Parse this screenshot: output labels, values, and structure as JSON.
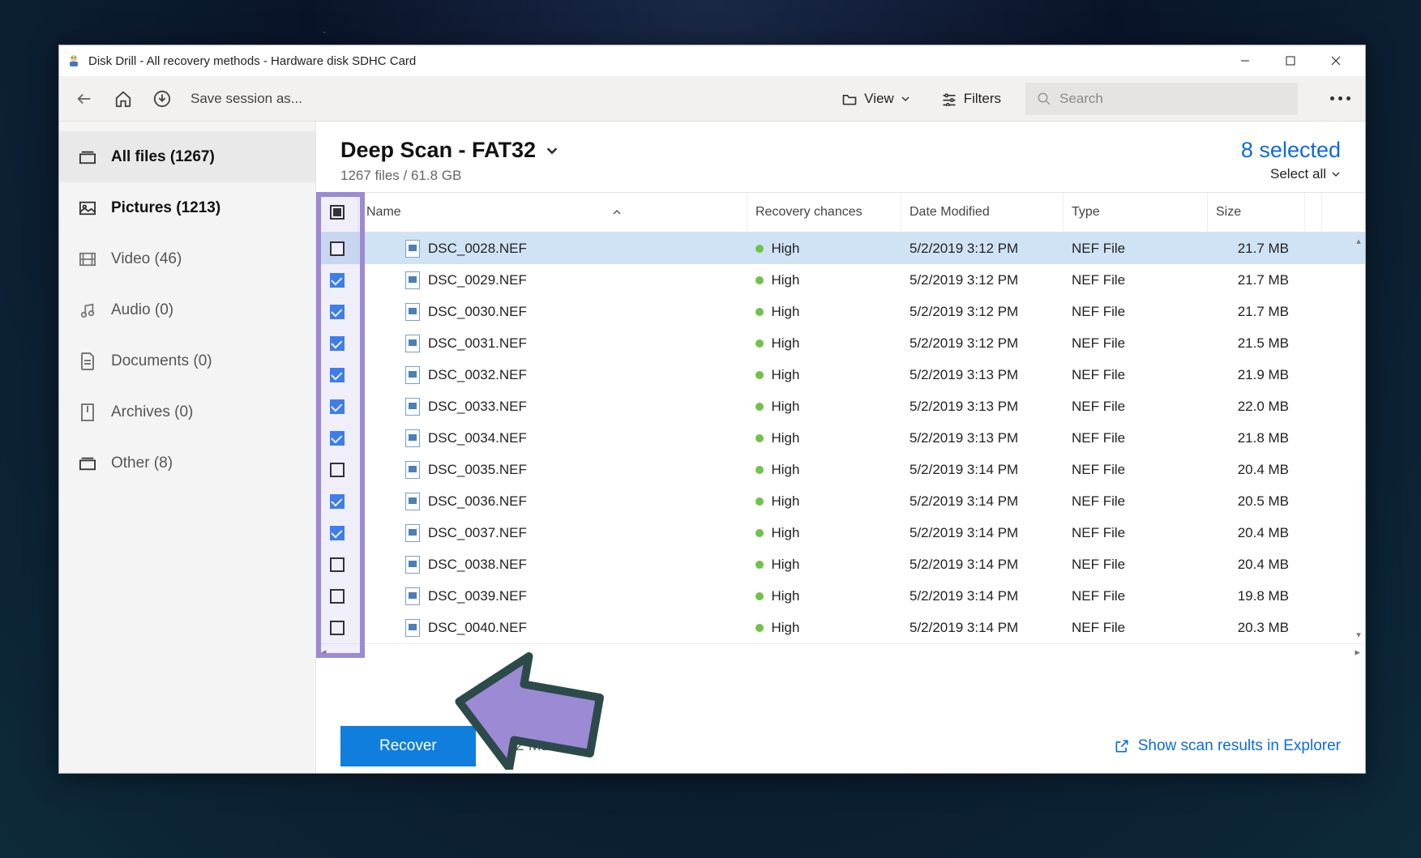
{
  "window": {
    "title": "Disk Drill - All recovery methods - Hardware disk SDHC Card"
  },
  "toolbar": {
    "save_session": "Save session as...",
    "view_label": "View",
    "filters_label": "Filters",
    "search_placeholder": "Search"
  },
  "sidebar": {
    "items": [
      {
        "label": "All files (1267)",
        "icon": "stack"
      },
      {
        "label": "Pictures (1213)",
        "icon": "picture"
      },
      {
        "label": "Video (46)",
        "icon": "video"
      },
      {
        "label": "Audio (0)",
        "icon": "audio"
      },
      {
        "label": "Documents (0)",
        "icon": "document"
      },
      {
        "label": "Archives (0)",
        "icon": "archive"
      },
      {
        "label": "Other (8)",
        "icon": "other"
      }
    ]
  },
  "main": {
    "scan_title": "Deep Scan - FAT32",
    "scan_sub": "1267 files / 61.8 GB",
    "selected_label": "8 selected",
    "select_all_label": "Select all"
  },
  "columns": {
    "name": "Name",
    "recovery": "Recovery chances",
    "modified": "Date Modified",
    "type": "Type",
    "size": "Size"
  },
  "rows": [
    {
      "checked": false,
      "name": "DSC_0028.NEF",
      "chance": "High",
      "modified": "5/2/2019 3:12 PM",
      "type": "NEF File",
      "size": "21.7 MB",
      "highlight": true
    },
    {
      "checked": true,
      "name": "DSC_0029.NEF",
      "chance": "High",
      "modified": "5/2/2019 3:12 PM",
      "type": "NEF File",
      "size": "21.7 MB"
    },
    {
      "checked": true,
      "name": "DSC_0030.NEF",
      "chance": "High",
      "modified": "5/2/2019 3:12 PM",
      "type": "NEF File",
      "size": "21.7 MB"
    },
    {
      "checked": true,
      "name": "DSC_0031.NEF",
      "chance": "High",
      "modified": "5/2/2019 3:12 PM",
      "type": "NEF File",
      "size": "21.5 MB"
    },
    {
      "checked": true,
      "name": "DSC_0032.NEF",
      "chance": "High",
      "modified": "5/2/2019 3:13 PM",
      "type": "NEF File",
      "size": "21.9 MB"
    },
    {
      "checked": true,
      "name": "DSC_0033.NEF",
      "chance": "High",
      "modified": "5/2/2019 3:13 PM",
      "type": "NEF File",
      "size": "22.0 MB"
    },
    {
      "checked": true,
      "name": "DSC_0034.NEF",
      "chance": "High",
      "modified": "5/2/2019 3:13 PM",
      "type": "NEF File",
      "size": "21.8 MB"
    },
    {
      "checked": false,
      "name": "DSC_0035.NEF",
      "chance": "High",
      "modified": "5/2/2019 3:14 PM",
      "type": "NEF File",
      "size": "20.4 MB"
    },
    {
      "checked": true,
      "name": "DSC_0036.NEF",
      "chance": "High",
      "modified": "5/2/2019 3:14 PM",
      "type": "NEF File",
      "size": "20.5 MB"
    },
    {
      "checked": true,
      "name": "DSC_0037.NEF",
      "chance": "High",
      "modified": "5/2/2019 3:14 PM",
      "type": "NEF File",
      "size": "20.4 MB"
    },
    {
      "checked": false,
      "name": "DSC_0038.NEF",
      "chance": "High",
      "modified": "5/2/2019 3:14 PM",
      "type": "NEF File",
      "size": "20.4 MB"
    },
    {
      "checked": false,
      "name": "DSC_0039.NEF",
      "chance": "High",
      "modified": "5/2/2019 3:14 PM",
      "type": "NEF File",
      "size": "19.8 MB"
    },
    {
      "checked": false,
      "name": "DSC_0040.NEF",
      "chance": "High",
      "modified": "5/2/2019 3:14 PM",
      "type": "NEF File",
      "size": "20.3 MB"
    }
  ],
  "footer": {
    "recover_label": "Recover",
    "stat": "172 MB",
    "explorer_link": "Show scan results in Explorer"
  }
}
